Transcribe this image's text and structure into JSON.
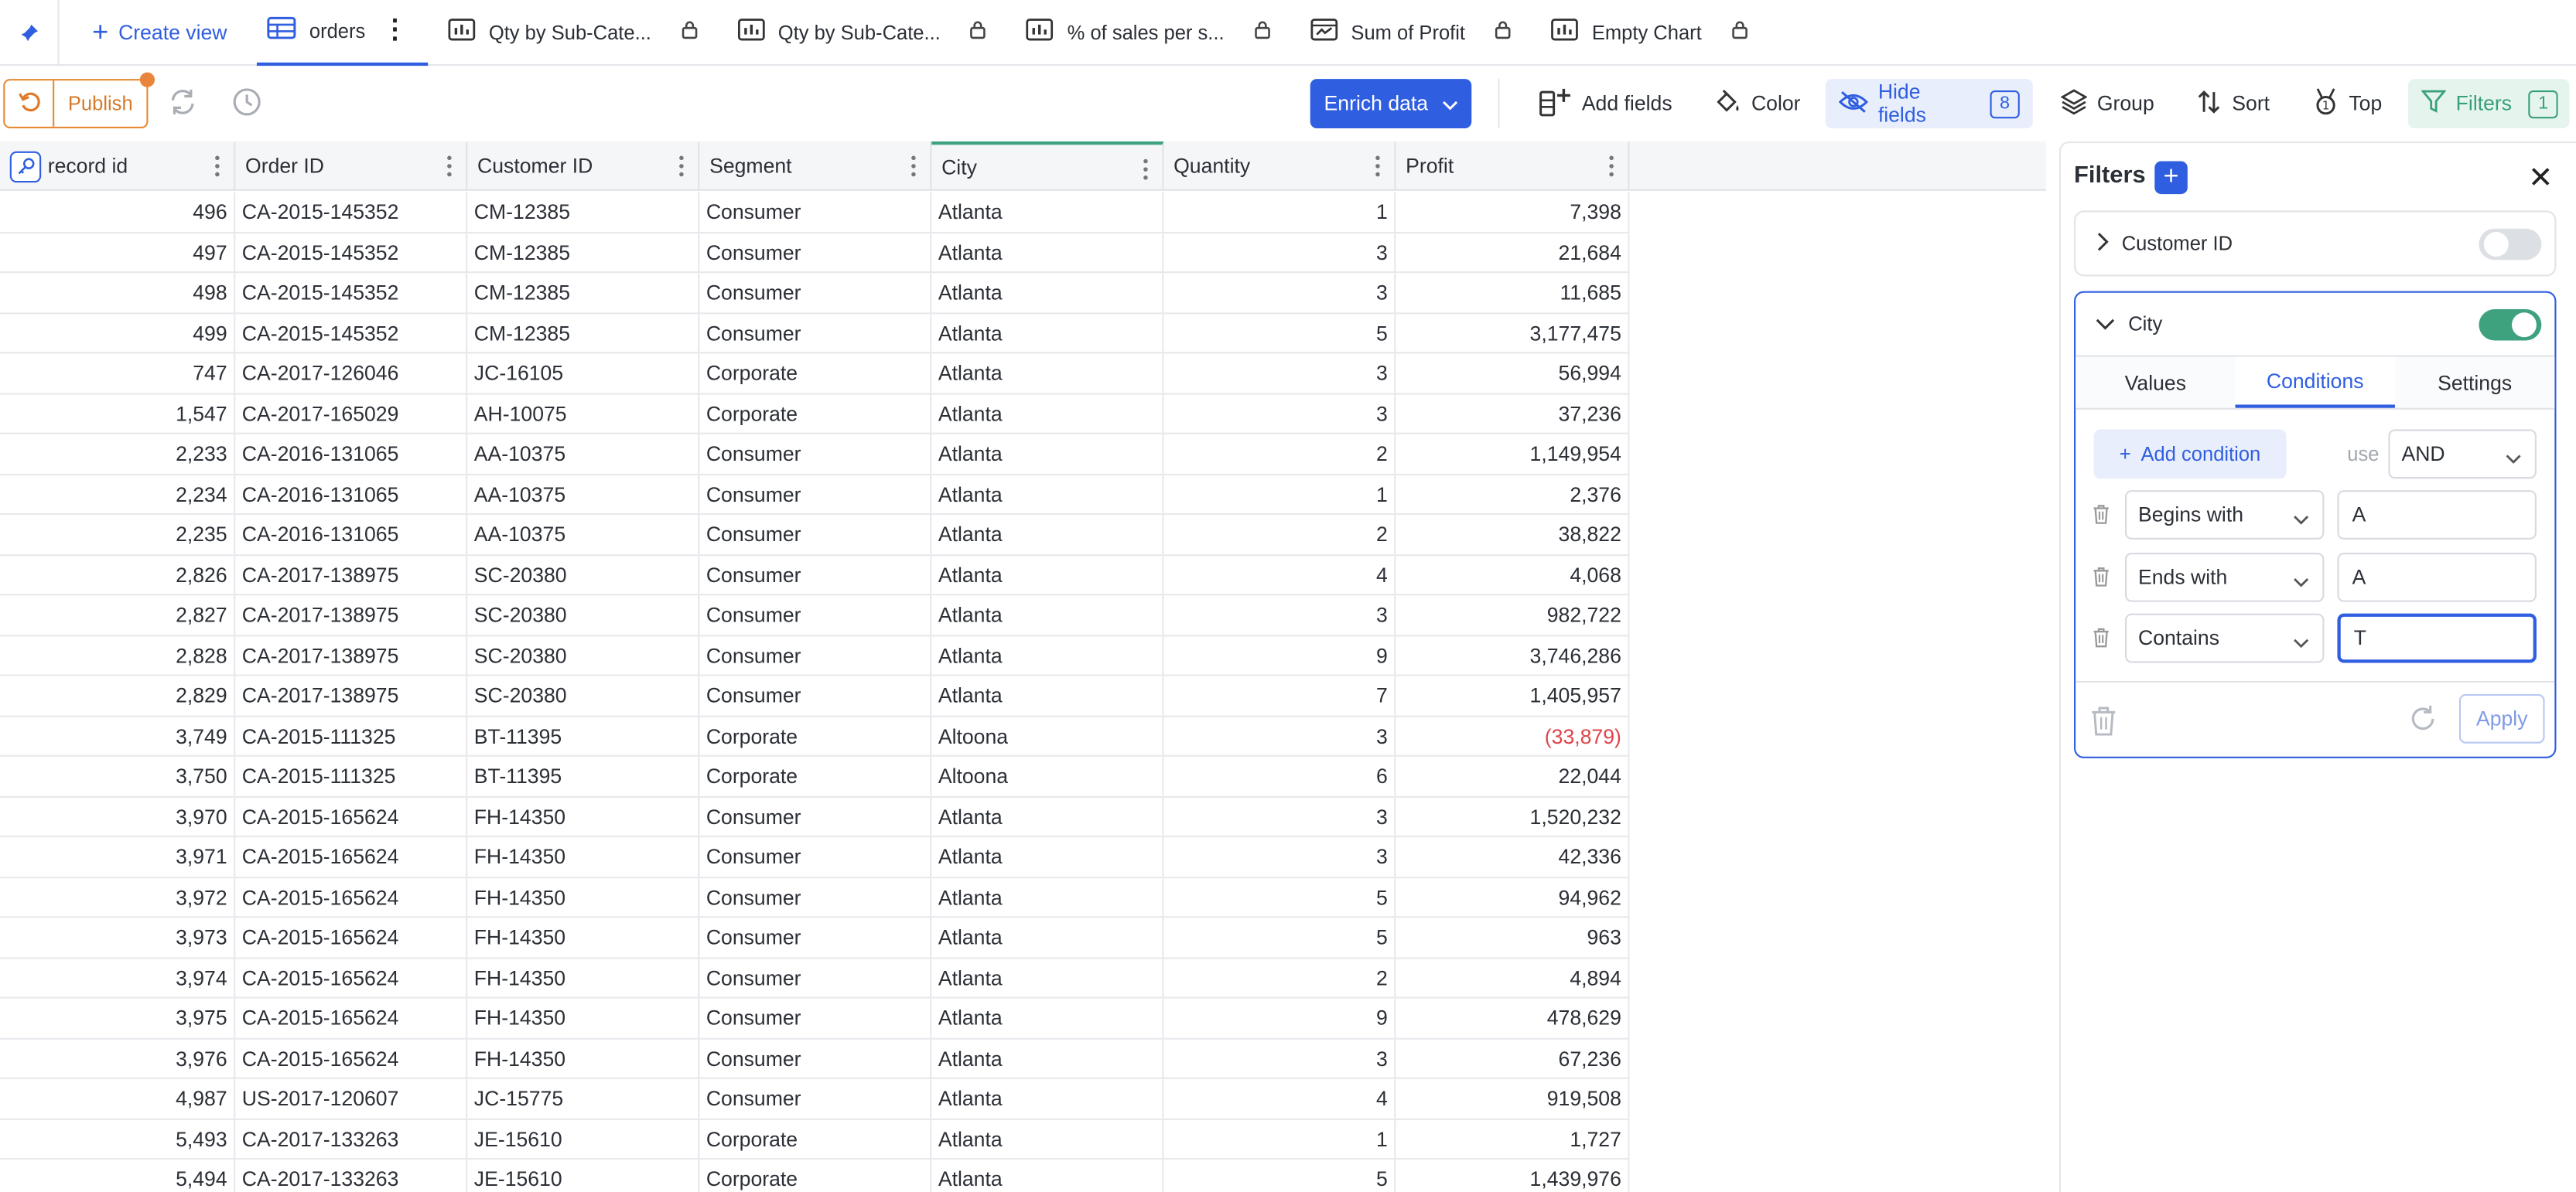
{
  "tabs": {
    "create_view_label": "Create view",
    "items": [
      {
        "label": "orders",
        "icon": "table-icon",
        "active": true,
        "locked": false
      },
      {
        "label": "Qty by Sub-Cate...",
        "icon": "bar-chart-icon",
        "locked": true
      },
      {
        "label": "Qty by Sub-Cate...",
        "icon": "bar-chart-icon",
        "locked": true
      },
      {
        "label": "% of sales per s...",
        "icon": "bar-chart-icon",
        "locked": true
      },
      {
        "label": "Sum of Profit",
        "icon": "kpi-card-icon",
        "locked": true
      },
      {
        "label": "Empty Chart",
        "icon": "bar-chart-icon",
        "locked": true
      }
    ]
  },
  "toolbar": {
    "publish_label": "Publish",
    "enrich_label": "Enrich data",
    "add_fields_label": "Add fields",
    "color_label": "Color",
    "hide_fields_label": "Hide fields",
    "hide_fields_count": "8",
    "group_label": "Group",
    "sort_label": "Sort",
    "top_label": "Top",
    "filters_label": "Filters",
    "filters_count": "1"
  },
  "grid": {
    "columns": [
      "record id",
      "Order ID",
      "Customer ID",
      "Segment",
      "City",
      "Quantity",
      "Profit"
    ],
    "rows": [
      [
        "496",
        "CA-2015-145352",
        "CM-12385",
        "Consumer",
        "Atlanta",
        "1",
        "7,398"
      ],
      [
        "497",
        "CA-2015-145352",
        "CM-12385",
        "Consumer",
        "Atlanta",
        "3",
        "21,684"
      ],
      [
        "498",
        "CA-2015-145352",
        "CM-12385",
        "Consumer",
        "Atlanta",
        "3",
        "11,685"
      ],
      [
        "499",
        "CA-2015-145352",
        "CM-12385",
        "Consumer",
        "Atlanta",
        "5",
        "3,177,475"
      ],
      [
        "747",
        "CA-2017-126046",
        "JC-16105",
        "Corporate",
        "Atlanta",
        "3",
        "56,994"
      ],
      [
        "1,547",
        "CA-2017-165029",
        "AH-10075",
        "Corporate",
        "Atlanta",
        "3",
        "37,236"
      ],
      [
        "2,233",
        "CA-2016-131065",
        "AA-10375",
        "Consumer",
        "Atlanta",
        "2",
        "1,149,954"
      ],
      [
        "2,234",
        "CA-2016-131065",
        "AA-10375",
        "Consumer",
        "Atlanta",
        "1",
        "2,376"
      ],
      [
        "2,235",
        "CA-2016-131065",
        "AA-10375",
        "Consumer",
        "Atlanta",
        "2",
        "38,822"
      ],
      [
        "2,826",
        "CA-2017-138975",
        "SC-20380",
        "Consumer",
        "Atlanta",
        "4",
        "4,068"
      ],
      [
        "2,827",
        "CA-2017-138975",
        "SC-20380",
        "Consumer",
        "Atlanta",
        "3",
        "982,722"
      ],
      [
        "2,828",
        "CA-2017-138975",
        "SC-20380",
        "Consumer",
        "Atlanta",
        "9",
        "3,746,286"
      ],
      [
        "2,829",
        "CA-2017-138975",
        "SC-20380",
        "Consumer",
        "Atlanta",
        "7",
        "1,405,957"
      ],
      [
        "3,749",
        "CA-2015-111325",
        "BT-11395",
        "Corporate",
        "Altoona",
        "3",
        "(33,879)"
      ],
      [
        "3,750",
        "CA-2015-111325",
        "BT-11395",
        "Corporate",
        "Altoona",
        "6",
        "22,044"
      ],
      [
        "3,970",
        "CA-2015-165624",
        "FH-14350",
        "Consumer",
        "Atlanta",
        "3",
        "1,520,232"
      ],
      [
        "3,971",
        "CA-2015-165624",
        "FH-14350",
        "Consumer",
        "Atlanta",
        "3",
        "42,336"
      ],
      [
        "3,972",
        "CA-2015-165624",
        "FH-14350",
        "Consumer",
        "Atlanta",
        "5",
        "94,962"
      ],
      [
        "3,973",
        "CA-2015-165624",
        "FH-14350",
        "Consumer",
        "Atlanta",
        "5",
        "963"
      ],
      [
        "3,974",
        "CA-2015-165624",
        "FH-14350",
        "Consumer",
        "Atlanta",
        "2",
        "4,894"
      ],
      [
        "3,975",
        "CA-2015-165624",
        "FH-14350",
        "Consumer",
        "Atlanta",
        "9",
        "478,629"
      ],
      [
        "3,976",
        "CA-2015-165624",
        "FH-14350",
        "Consumer",
        "Atlanta",
        "3",
        "67,236"
      ],
      [
        "4,987",
        "US-2017-120607",
        "JC-15775",
        "Consumer",
        "Atlanta",
        "4",
        "919,508"
      ],
      [
        "5,493",
        "CA-2017-133263",
        "JE-15610",
        "Corporate",
        "Atlanta",
        "1",
        "1,727"
      ],
      [
        "5,494",
        "CA-2017-133263",
        "JE-15610",
        "Corporate",
        "Atlanta",
        "5",
        "1,439,976"
      ]
    ]
  },
  "filters_panel": {
    "title": "Filters",
    "filters": [
      {
        "field": "Customer ID",
        "enabled": false,
        "expanded": false
      },
      {
        "field": "City",
        "enabled": true,
        "expanded": true
      }
    ],
    "tabs": [
      "Values",
      "Conditions",
      "Settings"
    ],
    "active_tab": "Conditions",
    "add_condition_label": "Add condition",
    "use_label": "use",
    "logic_operator": "AND",
    "conditions": [
      {
        "operator": "Begins with",
        "value": "A"
      },
      {
        "operator": "Ends with",
        "value": "A"
      },
      {
        "operator": "Contains",
        "value": "T"
      }
    ],
    "apply_label": "Apply"
  },
  "colors": {
    "accent": "#2f5ee0",
    "filter_green": "#3ea27e",
    "publish_orange": "#e88a35",
    "negative_red": "#e0434b"
  }
}
